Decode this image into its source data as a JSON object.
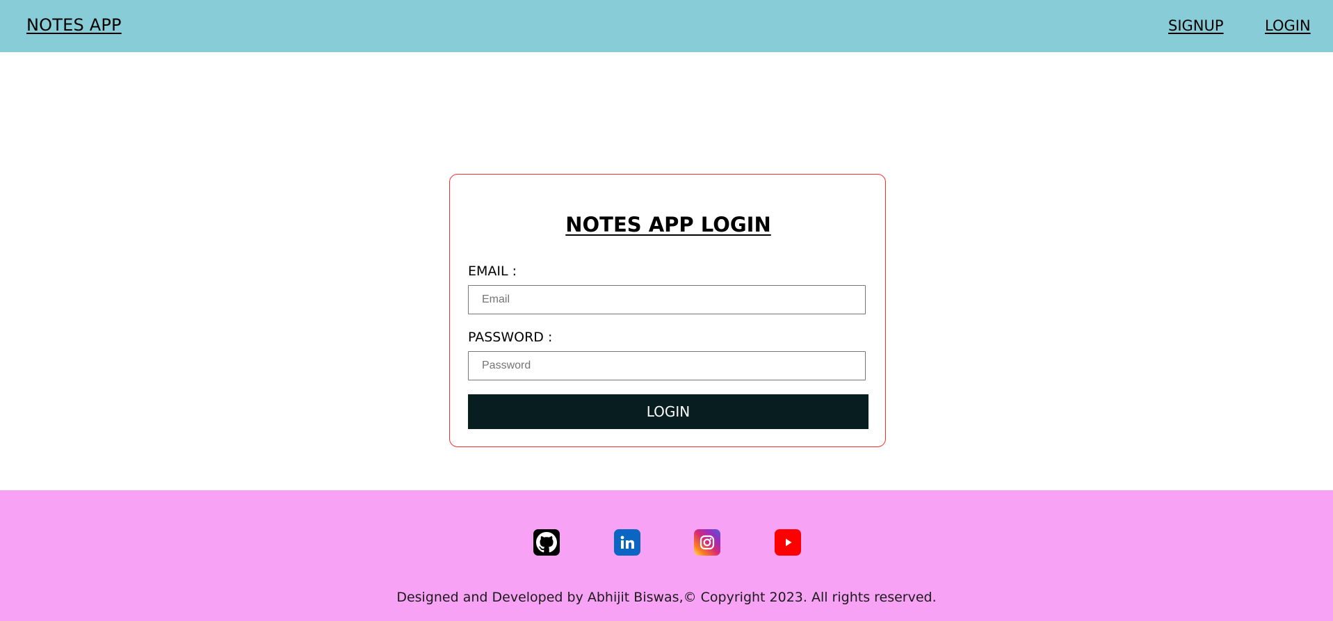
{
  "navbar": {
    "brand": "NOTES APP",
    "links": {
      "signup": "SIGNUP",
      "login": "LOGIN"
    },
    "background": "#87ccd6"
  },
  "login_card": {
    "title": "NOTES APP LOGIN",
    "email_label": "EMAIL :",
    "email_placeholder": "Email",
    "email_value": "",
    "password_label": "PASSWORD :",
    "password_placeholder": "Password",
    "password_value": "",
    "submit_label": "LOGIN",
    "border_color": "#ff2b2b",
    "button_color": "#071d1f"
  },
  "footer": {
    "background": "#f7a2f5",
    "social_icons": [
      "github-icon",
      "linkedin-icon",
      "instagram-icon",
      "youtube-icon"
    ],
    "copyright": "Designed and Developed by Abhijit Biswas,© Copyright 2023. All rights reserved."
  }
}
